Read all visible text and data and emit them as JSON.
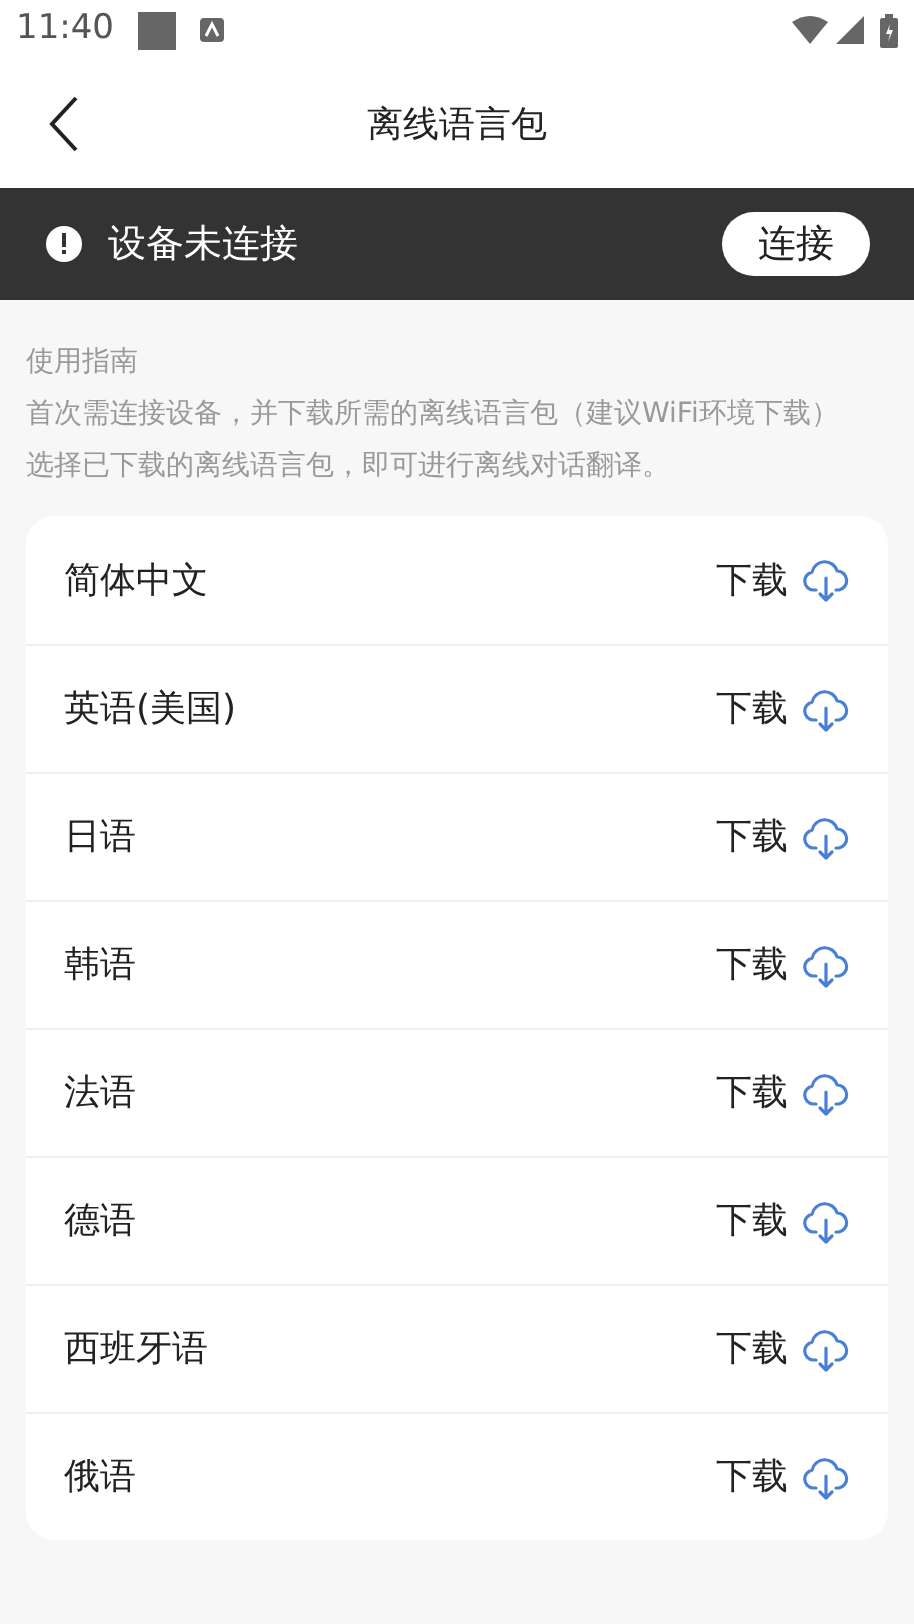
{
  "status_bar": {
    "time": "11:40"
  },
  "header": {
    "title": "离线语言包"
  },
  "banner": {
    "message": "设备未连接",
    "button": "连接"
  },
  "guide": {
    "title": "使用指南",
    "lines": [
      "首次需连接设备，并下载所需的离线语言包（建议WiFi环境下载）",
      "选择已下载的离线语言包，即可进行离线对话翻译。"
    ]
  },
  "languages": [
    {
      "name": "简体中文",
      "action": "下载"
    },
    {
      "name": "英语(美国)",
      "action": "下载"
    },
    {
      "name": "日语",
      "action": "下载"
    },
    {
      "name": "韩语",
      "action": "下载"
    },
    {
      "name": "法语",
      "action": "下载"
    },
    {
      "name": "德语",
      "action": "下载"
    },
    {
      "name": "西班牙语",
      "action": "下载"
    },
    {
      "name": "俄语",
      "action": "下载"
    }
  ]
}
